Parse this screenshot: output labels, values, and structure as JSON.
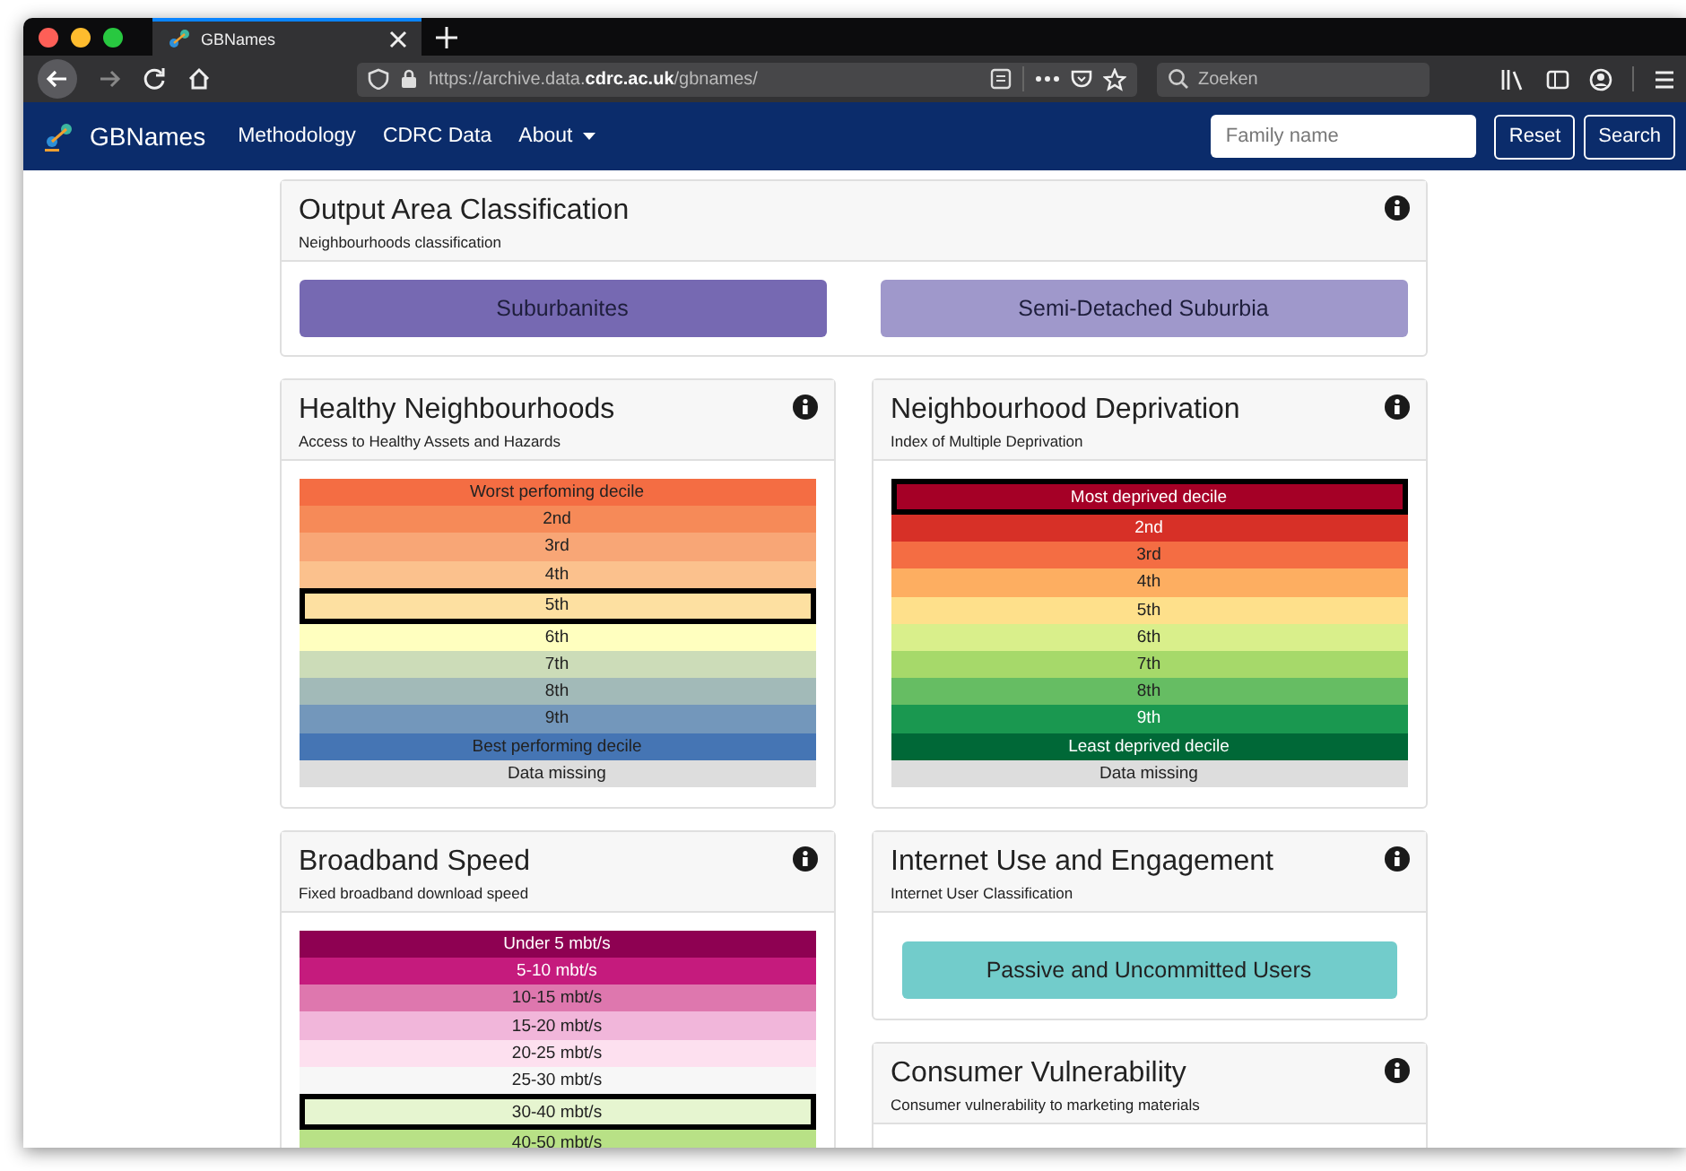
{
  "browser": {
    "tab_title": "GBNames",
    "url": "https://archive.data.**cdrc.ac.uk**/gbnames/",
    "search_placeholder": "Zoeken"
  },
  "navbar": {
    "brand": "GBNames",
    "links": [
      {
        "label": "Methodology",
        "dropdown": false
      },
      {
        "label": "CDRC Data",
        "dropdown": false
      },
      {
        "label": "About",
        "dropdown": true
      }
    ],
    "search": {
      "placeholder": "Family name"
    },
    "buttons": [
      "Reset",
      "Search"
    ]
  },
  "top_card": {
    "title": "Output Area Classification",
    "subtitle": "Neighbourhoods classification",
    "kind": "buttons",
    "buttons": [
      {
        "label": "Suburbanites",
        "color": "#7669b2"
      },
      {
        "label": "Semi-Detached Suburbia",
        "color": "#9f98cb"
      }
    ]
  },
  "columns": [
    [
      {
        "title": "Healthy Neighbourhoods",
        "subtitle": "Access to Healthy Assets and Hazards",
        "kind": "legend",
        "items": [
          {
            "label": "Worst perfoming decile",
            "color": "#f46d43",
            "light_text": false,
            "selected": false
          },
          {
            "label": "2nd",
            "color": "#f68a58",
            "light_text": false,
            "selected": false
          },
          {
            "label": "3rd",
            "color": "#f8a676",
            "light_text": false,
            "selected": false
          },
          {
            "label": "4th",
            "color": "#fbc18d",
            "light_text": false,
            "selected": false
          },
          {
            "label": "5th",
            "color": "#fde0a1",
            "light_text": false,
            "selected": true
          },
          {
            "label": "6th",
            "color": "#ffffbf",
            "light_text": false,
            "selected": false
          },
          {
            "label": "7th",
            "color": "#ccdcb8",
            "light_text": false,
            "selected": false
          },
          {
            "label": "8th",
            "color": "#a2bab8",
            "light_text": false,
            "selected": false
          },
          {
            "label": "9th",
            "color": "#7397bb",
            "light_text": false,
            "selected": false
          },
          {
            "label": "Best performing decile",
            "color": "#4575b4",
            "light_text": false,
            "selected": false
          },
          {
            "label": "Data missing",
            "color": "#dddddd",
            "light_text": false,
            "selected": false
          }
        ]
      },
      {
        "title": "Broadband Speed",
        "subtitle": "Fixed broadband download speed",
        "kind": "legend",
        "items": [
          {
            "label": "Under 5 mbt/s",
            "color": "#8e0152",
            "light_text": true,
            "selected": false
          },
          {
            "label": "5-10 mbt/s",
            "color": "#c51b7d",
            "light_text": true,
            "selected": false
          },
          {
            "label": "10-15 mbt/s",
            "color": "#de77ae",
            "light_text": false,
            "selected": false
          },
          {
            "label": "15-20 mbt/s",
            "color": "#f1b6da",
            "light_text": false,
            "selected": false
          },
          {
            "label": "20-25 mbt/s",
            "color": "#fde0ef",
            "light_text": false,
            "selected": false
          },
          {
            "label": "25-30 mbt/s",
            "color": "#f7f7f7",
            "light_text": false,
            "selected": false
          },
          {
            "label": "30-40 mbt/s",
            "color": "#e6f5d0",
            "light_text": false,
            "selected": true
          },
          {
            "label": "40-50 mbt/s",
            "color": "#b8e186",
            "light_text": false,
            "selected": false
          }
        ]
      }
    ],
    [
      {
        "title": "Neighbourhood Deprivation",
        "subtitle": "Index of Multiple Deprivation",
        "kind": "legend",
        "items": [
          {
            "label": "Most deprived decile",
            "color": "#a50026",
            "light_text": true,
            "selected": true
          },
          {
            "label": "2nd",
            "color": "#d73027",
            "light_text": true,
            "selected": false
          },
          {
            "label": "3rd",
            "color": "#f46d43",
            "light_text": false,
            "selected": false
          },
          {
            "label": "4th",
            "color": "#fdae61",
            "light_text": false,
            "selected": false
          },
          {
            "label": "5th",
            "color": "#fee08b",
            "light_text": false,
            "selected": false
          },
          {
            "label": "6th",
            "color": "#d9ef8b",
            "light_text": false,
            "selected": false
          },
          {
            "label": "7th",
            "color": "#a6d96a",
            "light_text": false,
            "selected": false
          },
          {
            "label": "8th",
            "color": "#66bd63",
            "light_text": false,
            "selected": false
          },
          {
            "label": "9th",
            "color": "#1a9850",
            "light_text": true,
            "selected": false
          },
          {
            "label": "Least deprived decile",
            "color": "#006837",
            "light_text": true,
            "selected": false
          },
          {
            "label": "Data missing",
            "color": "#dddddd",
            "light_text": false,
            "selected": false
          }
        ]
      },
      {
        "title": "Internet Use and Engagement",
        "subtitle": "Internet User Classification",
        "kind": "buttons",
        "buttons": [
          {
            "label": "Passive and Uncommitted Users",
            "color": "#72cccb"
          }
        ]
      },
      {
        "title": "Consumer Vulnerability",
        "subtitle": "Consumer vulnerability to marketing materials",
        "kind": "empty"
      }
    ]
  ]
}
